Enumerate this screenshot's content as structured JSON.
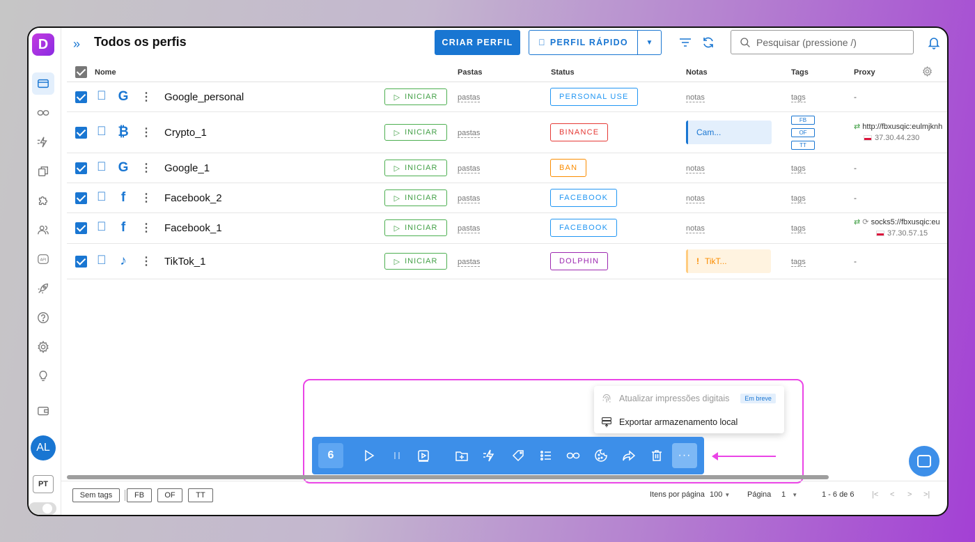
{
  "app": {
    "logo_letter": "D",
    "title": "Todos os perfis"
  },
  "header": {
    "create_label": "CRIAR PERFIL",
    "quick_label": "PERFIL RÁPIDO",
    "search_placeholder": "Pesquisar (pressione /)"
  },
  "table": {
    "columns": {
      "name": "Nome",
      "folders": "Pastas",
      "status": "Status",
      "notes": "Notas",
      "tags": "Tags",
      "proxy": "Proxy"
    },
    "start_label": "INICIAR",
    "folders_placeholder": "pastas",
    "notes_placeholder": "notas",
    "tags_placeholder": "tags",
    "rows": [
      {
        "name": "Google_personal",
        "site_icon": "G",
        "status": "PERSONAL USE",
        "status_color": "#2196f3",
        "proxy": "-"
      },
      {
        "name": "Crypto_1",
        "site_icon": "₿",
        "status": "BINANCE",
        "status_color": "#e53935",
        "note": "Cam...",
        "tags": [
          "FB",
          "OF",
          "TT"
        ],
        "proxy": "http://fbxusqic:eulmjknh",
        "proxy_ip": "37.30.44.230"
      },
      {
        "name": "Google_1",
        "site_icon": "G",
        "status": "BAN",
        "status_color": "#fb8c00",
        "proxy": "-"
      },
      {
        "name": "Facebook_2",
        "site_icon": "f",
        "status": "FACEBOOK",
        "status_color": "#2196f3",
        "proxy": "-"
      },
      {
        "name": "Facebook_1",
        "site_icon": "f",
        "status": "FACEBOOK",
        "status_color": "#2196f3",
        "proxy": "socks5://fbxusqic:eu",
        "proxy_ip": "37.30.57.15"
      },
      {
        "name": "TikTok_1",
        "site_icon": "♪",
        "status": "DOLPHIN",
        "status_color": "#9c27b0",
        "note": "TikT...",
        "proxy": "-"
      }
    ]
  },
  "bulk": {
    "selected_count": "6",
    "more_label": "···",
    "menu": {
      "update_fingerprints": "Atualizar impressões digitais",
      "soon_badge": "Em breve",
      "export_storage": "Exportar armazenamento local"
    }
  },
  "sidebar": {
    "avatar": "AL",
    "lang": "PT"
  },
  "footer": {
    "tags": [
      "Sem tags",
      "FB",
      "OF",
      "TT"
    ],
    "items_per_page_label": "Itens por página",
    "items_per_page_value": "100",
    "page_label": "Página",
    "page_value": "1",
    "range": "1 - 6 de 6"
  },
  "colors": {
    "accent": "#1976d2",
    "highlight": "#ea44e6",
    "success": "#43a047"
  }
}
